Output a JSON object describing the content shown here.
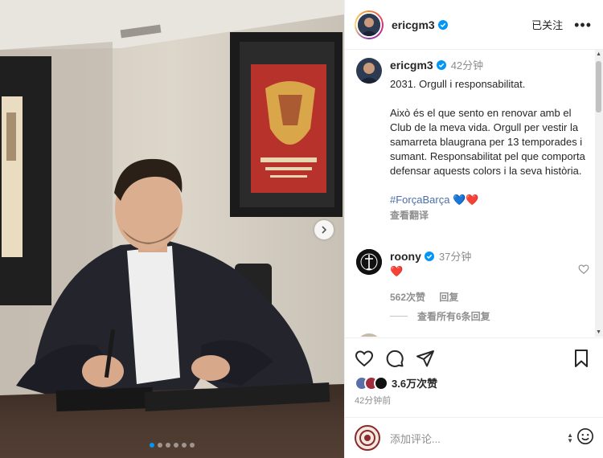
{
  "post": {
    "username": "ericgm3",
    "follow_label": "已关注",
    "more_label": "•••",
    "caption_time": "42分钟",
    "caption_lines": [
      "2031. Orgull i responsabilitat.",
      "Això és el que sento en renovar amb el Club de la meva vida. Orgull per vestir la samarreta blaugrana per 13 temporades i sumant. Responsabilitat pel que comporta defensar aquests colors i la seva història."
    ],
    "hashtag": "#ForçaBarça",
    "hashtag_emojis": "💙❤️",
    "translate_label": "查看翻译",
    "likes": "3.6万次赞",
    "posted": "42分钟前",
    "comment_placeholder": "添加评论..."
  },
  "comment": {
    "username": "roony",
    "time": "37分钟",
    "text": "❤️",
    "likes": "562次赞",
    "reply_label": "回复",
    "view_replies": "查看所有6条回复"
  },
  "photo": {
    "slide_count": 6,
    "active_slide": 0
  },
  "colors": {
    "accent": "#0095f6",
    "verified": "#0095f6",
    "hashtag": "#4a6ea8",
    "secondary_text": "#8e8e8e"
  },
  "icons": [
    "verified-badge-icon",
    "heart-icon",
    "comment-icon",
    "share-icon",
    "bookmark-icon",
    "chevron-right-icon",
    "emoji-icon"
  ]
}
